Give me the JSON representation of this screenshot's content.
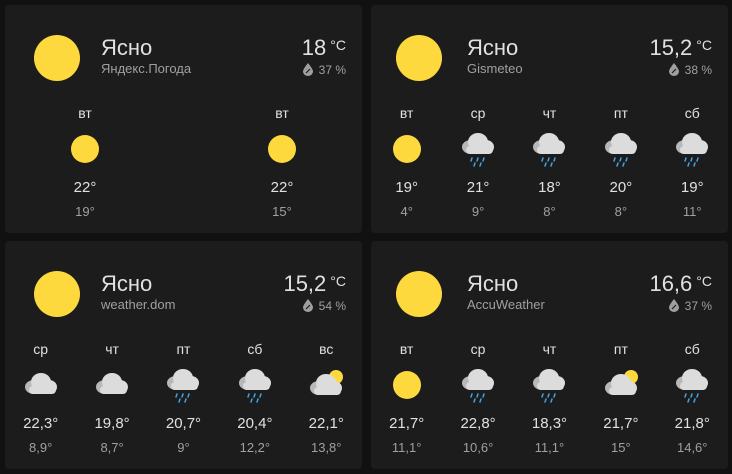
{
  "cards": [
    {
      "condition": "Ясно",
      "source": "Яндекс.Погода",
      "temp": "18",
      "unit": "°C",
      "humidity": "37 %",
      "forecast": [
        {
          "day": "вт",
          "icon": "sun-icon",
          "hi": "22°",
          "lo": "19°"
        },
        {
          "day": "вт",
          "icon": "sun-icon",
          "hi": "22°",
          "lo": "15°"
        }
      ]
    },
    {
      "condition": "Ясно",
      "source": "Gismeteo",
      "temp": "15,2",
      "unit": "°C",
      "humidity": "38 %",
      "forecast": [
        {
          "day": "вт",
          "icon": "sun-icon",
          "hi": "19°",
          "lo": "4°"
        },
        {
          "day": "ср",
          "icon": "rain-cloud-icon",
          "hi": "21°",
          "lo": "9°"
        },
        {
          "day": "чт",
          "icon": "rain-cloud-icon",
          "hi": "18°",
          "lo": "8°"
        },
        {
          "day": "пт",
          "icon": "rain-cloud-icon",
          "hi": "20°",
          "lo": "8°"
        },
        {
          "day": "сб",
          "icon": "rain-cloud-icon",
          "hi": "19°",
          "lo": "11°"
        }
      ]
    },
    {
      "condition": "Ясно",
      "source": "weather.dom",
      "temp": "15,2",
      "unit": "°C",
      "humidity": "54 %",
      "forecast": [
        {
          "day": "ср",
          "icon": "cloud-icon",
          "hi": "22,3°",
          "lo": "8,9°"
        },
        {
          "day": "чт",
          "icon": "cloud-icon",
          "hi": "19,8°",
          "lo": "8,7°"
        },
        {
          "day": "пт",
          "icon": "rain-cloud-icon",
          "hi": "20,7°",
          "lo": "9°"
        },
        {
          "day": "сб",
          "icon": "rain-cloud-icon",
          "hi": "20,4°",
          "lo": "12,2°"
        },
        {
          "day": "вс",
          "icon": "partly-cloudy-icon",
          "hi": "22,1°",
          "lo": "13,8°"
        }
      ]
    },
    {
      "condition": "Ясно",
      "source": "AccuWeather",
      "temp": "16,6",
      "unit": "°C",
      "humidity": "37 %",
      "forecast": [
        {
          "day": "вт",
          "icon": "sun-icon",
          "hi": "21,7°",
          "lo": "11,1°"
        },
        {
          "day": "ср",
          "icon": "rain-cloud-icon",
          "hi": "22,8°",
          "lo": "10,6°"
        },
        {
          "day": "чт",
          "icon": "rain-cloud-icon",
          "hi": "18,3°",
          "lo": "11,1°"
        },
        {
          "day": "пт",
          "icon": "partly-cloudy-icon",
          "hi": "21,7°",
          "lo": "15°"
        },
        {
          "day": "сб",
          "icon": "rain-cloud-icon",
          "hi": "21,8°",
          "lo": "14,6°"
        }
      ]
    }
  ],
  "colors": {
    "sun": "#fdd93d",
    "cloud": "#dcdcdc",
    "rain": "#44a0e0",
    "card": "#1c1c1c",
    "background": "#111111"
  }
}
